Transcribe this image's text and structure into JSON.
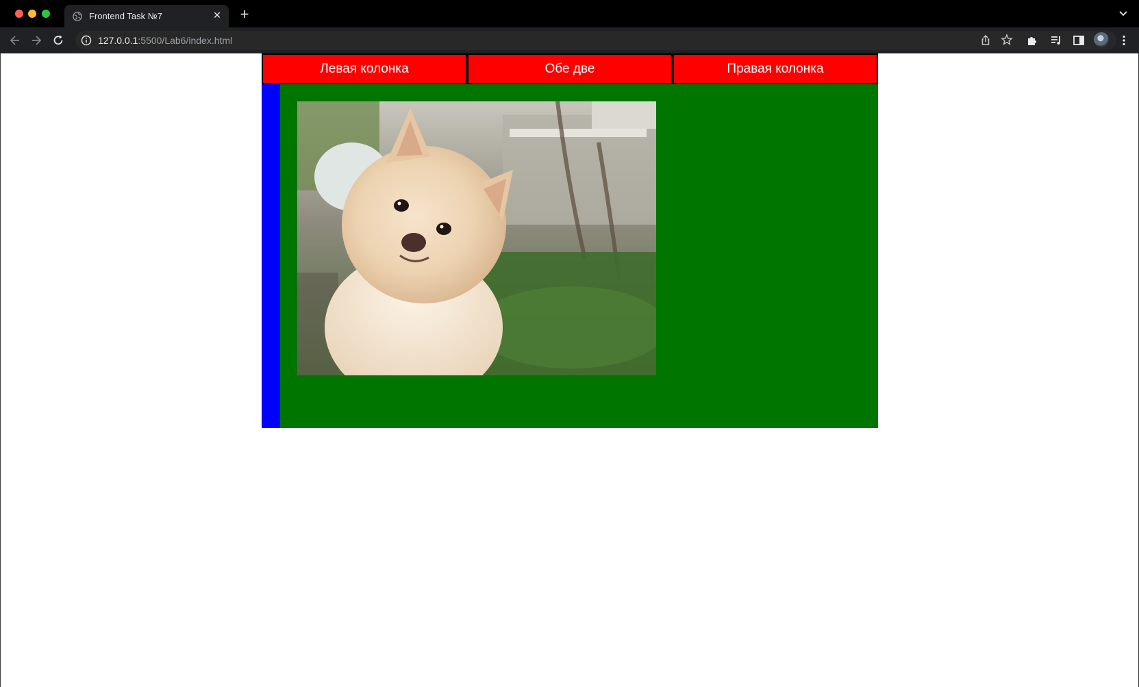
{
  "browser": {
    "tab_title": "Frontend Task №7",
    "url_host": "127.0.0.1",
    "url_rest": ":5500/Lab6/index.html",
    "icons": [
      "globe-icon",
      "close-icon",
      "plus-icon",
      "chevron-down-icon",
      "back-icon",
      "forward-icon",
      "reload-icon",
      "info-icon",
      "share-icon",
      "star-icon",
      "extensions-icon",
      "media-icon",
      "sidepanel-icon",
      "kebab-menu-icon"
    ]
  },
  "page": {
    "nav": {
      "left_label": "Левая колонка",
      "both_label": "Обе две",
      "right_label": "Правая колонка"
    },
    "colors": {
      "nav_bg": "#ff0000",
      "content_bg": "#007500",
      "left_column": "#0000ff"
    },
    "image": "pomeranian-dog-photo"
  }
}
